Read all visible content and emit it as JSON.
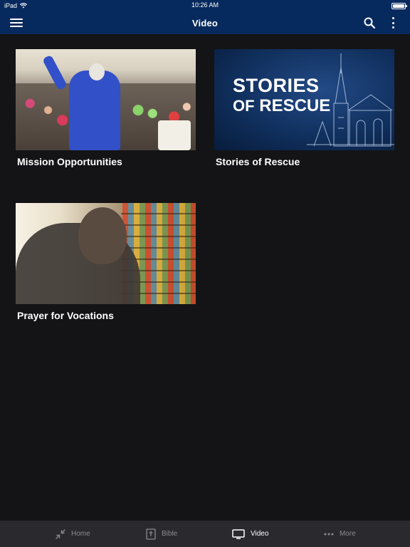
{
  "status_bar": {
    "device": "iPad",
    "time": "10:26 AM"
  },
  "header": {
    "title": "Video"
  },
  "videos": [
    {
      "title": "Mission Opportunities"
    },
    {
      "title": "Stories of Rescue",
      "thumbnail_text": {
        "line1": "STORIES",
        "line2_prefix": "OF",
        "line2": "RESCUE"
      }
    },
    {
      "title": "Prayer for Vocations"
    }
  ],
  "tabbar": {
    "items": [
      {
        "label": "Home",
        "icon": "collapse-arrows-icon",
        "active": false
      },
      {
        "label": "Bible",
        "icon": "bible-icon",
        "active": false
      },
      {
        "label": "Video",
        "icon": "tv-icon",
        "active": true
      },
      {
        "label": "More",
        "icon": "ellipsis-icon",
        "active": false
      }
    ]
  },
  "colors": {
    "header_bg": "#072a5e",
    "page_bg": "#141416",
    "tabbar_bg": "#2a2a2e",
    "tab_inactive": "#8a8a90",
    "tab_active": "#ffffff"
  }
}
